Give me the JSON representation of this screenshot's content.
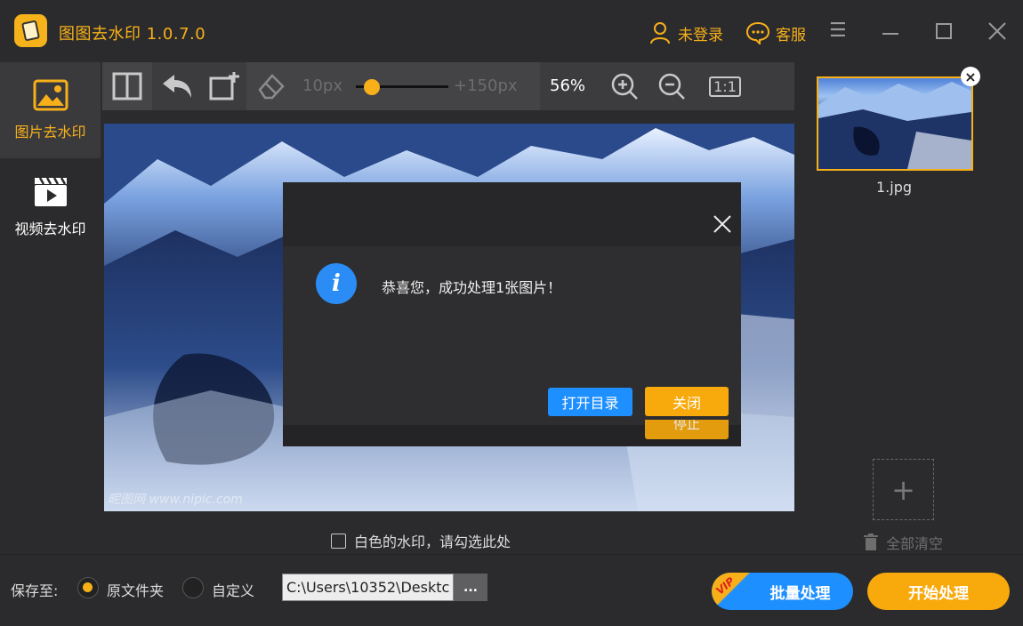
{
  "app": {
    "title": "图图去水印  1.0.7.0"
  },
  "header": {
    "login_label": "未登录",
    "service_label": "客服"
  },
  "sidebar": {
    "items": [
      {
        "label": "图片去水印",
        "icon": "image-icon",
        "active": true
      },
      {
        "label": "视频去水印",
        "icon": "video-clapper-icon",
        "active": false
      }
    ]
  },
  "toolbar": {
    "brush_min": "10px",
    "brush_max": "+150px",
    "brush_level": 0.1,
    "zoom": "56%",
    "actual_size_label": "1:1"
  },
  "canvas": {
    "watermark_text": "昵图网 www.nipic.com"
  },
  "options": {
    "white_watermark_label": "白色的水印，请勾选此处"
  },
  "file_list": {
    "items": [
      {
        "name": "1.jpg"
      }
    ],
    "clear_all_label": "全部清空"
  },
  "save": {
    "label": "保存至:",
    "option_original": "原文件夹",
    "option_custom": "自定义",
    "selected": "原文件夹",
    "path_value": "C:\\Users\\10352\\Desktc",
    "browse_label": "..."
  },
  "actions": {
    "vip_tag": "VIP",
    "batch_label": "批量处理",
    "start_label": "开始处理"
  },
  "dialog": {
    "message": "恭喜您，成功处理1张图片！",
    "open_folder_label": "打开目录",
    "close_label": "关闭",
    "stop_label": "停止"
  },
  "colors": {
    "accent": "#f7b019",
    "primary_blue": "#1e8fff",
    "background": "#2b2b2d"
  }
}
